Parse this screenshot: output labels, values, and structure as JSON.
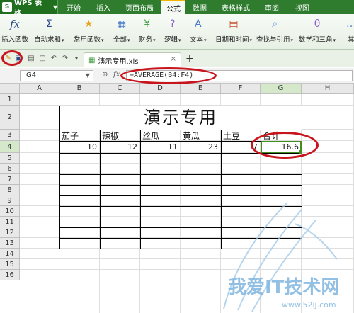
{
  "app": {
    "name": "WPS 表格",
    "logo": "S"
  },
  "menu": {
    "tabs": [
      "开始",
      "插入",
      "页面布局",
      "公式",
      "数据",
      "表格样式",
      "审阅",
      "视图"
    ],
    "active_index": 3
  },
  "ribbon": {
    "items": [
      {
        "label": "插入函数",
        "icon": "fx-icon",
        "glyph": "fx",
        "color": "#2b4a8a",
        "dd": false
      },
      {
        "label": "自动求和",
        "icon": "sigma-icon",
        "glyph": "Σ",
        "color": "#2b4a8a",
        "dd": true
      },
      {
        "label": "常用函数",
        "icon": "star-icon",
        "glyph": "★",
        "color": "#e7a21a",
        "dd": true
      },
      {
        "label": "全部",
        "icon": "all-functions-icon",
        "glyph": "▦",
        "color": "#4a7bc8",
        "dd": true
      },
      {
        "label": "财务",
        "icon": "finance-icon",
        "glyph": "¥",
        "color": "#3c9a3c",
        "dd": true
      },
      {
        "label": "逻辑",
        "icon": "logic-icon",
        "glyph": "?",
        "color": "#8a5bc8",
        "dd": true
      },
      {
        "label": "文本",
        "icon": "text-icon",
        "glyph": "A",
        "color": "#4a7bc8",
        "dd": true
      },
      {
        "label": "日期和时间",
        "icon": "calendar-icon",
        "glyph": "▤",
        "color": "#c8502b",
        "dd": true
      },
      {
        "label": "查找与引用",
        "icon": "lookup-icon",
        "glyph": "⌕",
        "color": "#4a7bc8",
        "dd": true
      },
      {
        "label": "数学和三角",
        "icon": "math-icon",
        "glyph": "θ",
        "color": "#8a5bc8",
        "dd": true
      },
      {
        "label": "其",
        "icon": "more-icon",
        "glyph": "…",
        "color": "#4a7bc8",
        "dd": false
      }
    ]
  },
  "document": {
    "tab_name": "演示专用.xls"
  },
  "formula_bar": {
    "cell_ref": "G4",
    "formula": "=AVERAGE(B4:F4)",
    "fx_label": "fx"
  },
  "sheet": {
    "columns": [
      "A",
      "B",
      "C",
      "D",
      "E",
      "F",
      "G",
      "H"
    ],
    "rows": [
      "1",
      "2",
      "3",
      "4",
      "5",
      "6",
      "7",
      "8",
      "9",
      "10",
      "11",
      "12",
      "13",
      "14",
      "15",
      "16"
    ],
    "selected_column": "G",
    "selected_row": "4",
    "title": "演示专用",
    "headers": [
      "茄子",
      "辣椒",
      "丝瓜",
      "黄瓜",
      "土豆",
      "合计"
    ],
    "values": [
      "10",
      "12",
      "11",
      "23",
      "7",
      "16.6"
    ]
  },
  "colors": {
    "menubar": "#2f7c2f",
    "accent_green": "#3f8f1f",
    "highlight_red": "#c8141c"
  },
  "watermark": {
    "main": "我爱IT技术网",
    "url": "www.52ij.com"
  }
}
